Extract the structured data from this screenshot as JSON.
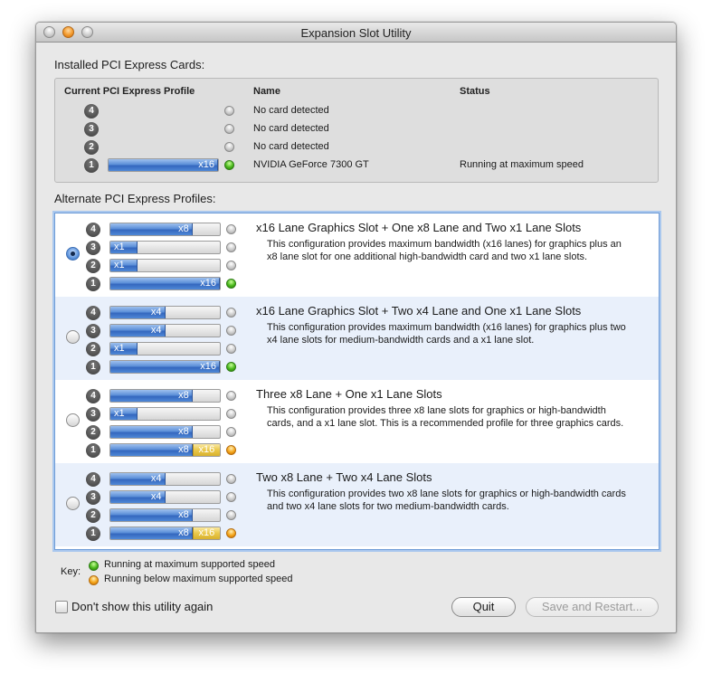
{
  "window": {
    "title": "Expansion Slot Utility"
  },
  "installed": {
    "heading": "Installed PCI Express Cards:",
    "col_profile": "Current PCI Express Profile",
    "col_name": "Name",
    "col_status": "Status",
    "rows": [
      {
        "slot": "4",
        "name": "No card detected",
        "status": "",
        "dot": "gray"
      },
      {
        "slot": "3",
        "name": "No card detected",
        "status": "",
        "dot": "gray"
      },
      {
        "slot": "2",
        "name": "No card detected",
        "status": "",
        "dot": "gray"
      },
      {
        "slot": "1",
        "name": "NVIDIA GeForce 7300 GT",
        "status": "Running at maximum speed",
        "dot": "green",
        "lane": "x16"
      }
    ]
  },
  "alternate": {
    "heading": "Alternate PCI Express Profiles:",
    "profiles": [
      {
        "selected": true,
        "title": "x16 Lane Graphics Slot + One x8 Lane and Two x1 Lane Slots",
        "description": "This configuration provides maximum bandwidth (x16 lanes) for graphics plus an x8 lane slot for one additional high-bandwidth card and two x1 lane slots.",
        "slots": [
          {
            "n": "4",
            "lane": "x8",
            "fill": 0.75,
            "dot": "gray"
          },
          {
            "n": "3",
            "lane": "x1",
            "fill": 0.25,
            "dot": "gray"
          },
          {
            "n": "2",
            "lane": "x1",
            "fill": 0.25,
            "dot": "gray"
          },
          {
            "n": "1",
            "lane": "x16",
            "fill": 1.0,
            "dot": "green"
          }
        ]
      },
      {
        "selected": false,
        "title": "x16 Lane Graphics Slot + Two x4 Lane and One x1 Lane Slots",
        "description": "This configuration provides maximum bandwidth (x16 lanes) for graphics plus two x4 lane slots for medium-bandwidth cards and a x1 lane slot.",
        "slots": [
          {
            "n": "4",
            "lane": "x4",
            "fill": 0.5,
            "dot": "gray"
          },
          {
            "n": "3",
            "lane": "x4",
            "fill": 0.5,
            "dot": "gray"
          },
          {
            "n": "2",
            "lane": "x1",
            "fill": 0.25,
            "dot": "gray"
          },
          {
            "n": "1",
            "lane": "x16",
            "fill": 1.0,
            "dot": "green"
          }
        ]
      },
      {
        "selected": false,
        "title": "Three x8 Lane + One x1 Lane Slots",
        "description": "This configuration provides three x8 lane slots for graphics or high-bandwidth cards, and a x1 lane slot.  This is a recommended profile for three graphics cards.",
        "slots": [
          {
            "n": "4",
            "lane": "x8",
            "fill": 0.75,
            "dot": "gray"
          },
          {
            "n": "3",
            "lane": "x1",
            "fill": 0.25,
            "dot": "gray"
          },
          {
            "n": "2",
            "lane": "x8",
            "fill": 0.75,
            "dot": "gray"
          },
          {
            "n": "1",
            "lane": "x8",
            "fill": 0.75,
            "over": "x16",
            "dot": "orange"
          }
        ]
      },
      {
        "selected": false,
        "title": "Two x8 Lane + Two x4 Lane Slots",
        "description": "This configuration provides two x8 lane slots for graphics or high-bandwidth cards and two x4 lane slots for two medium-bandwidth cards.",
        "slots": [
          {
            "n": "4",
            "lane": "x4",
            "fill": 0.5,
            "dot": "gray"
          },
          {
            "n": "3",
            "lane": "x4",
            "fill": 0.5,
            "dot": "gray"
          },
          {
            "n": "2",
            "lane": "x8",
            "fill": 0.75,
            "dot": "gray"
          },
          {
            "n": "1",
            "lane": "x8",
            "fill": 0.75,
            "over": "x16",
            "dot": "orange"
          }
        ]
      }
    ]
  },
  "key": {
    "label": "Key:",
    "green": "Running at maximum supported speed",
    "orange": "Running below maximum supported speed"
  },
  "footer": {
    "dont_show": "Don't show this utility again",
    "quit": "Quit",
    "save_restart": "Save and Restart..."
  }
}
